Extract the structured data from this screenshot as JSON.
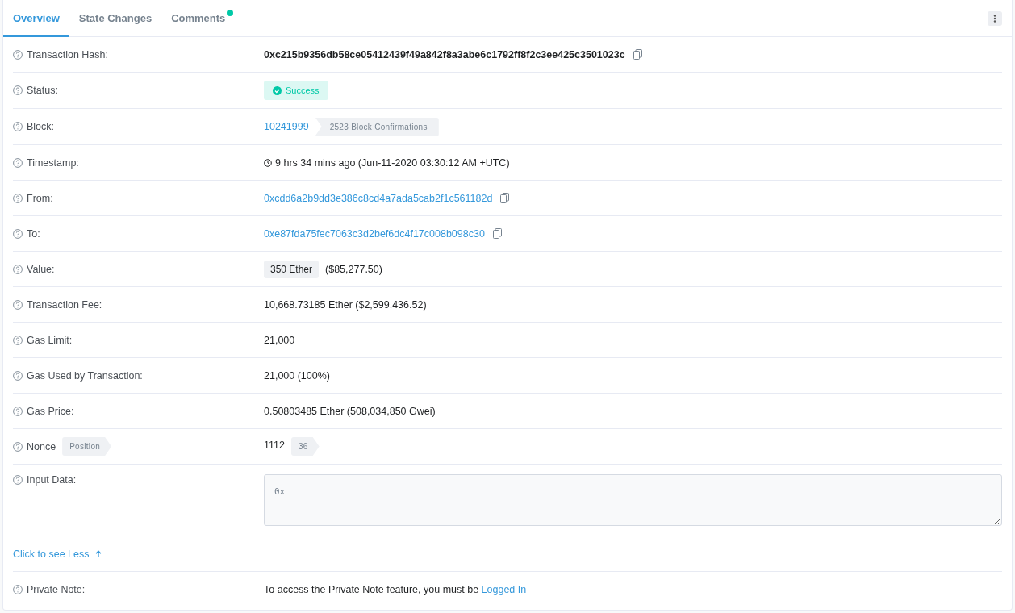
{
  "tabs": [
    {
      "label": "Overview",
      "selected": true,
      "dot": false
    },
    {
      "label": "State Changes",
      "selected": false,
      "dot": false
    },
    {
      "label": "Comments",
      "selected": false,
      "dot": true
    }
  ],
  "rows": [
    {
      "kind": "hash",
      "label": "Transaction Hash:",
      "value": "0xc215b9356db58ce05412439f49a842f8a3abe6c1792ff8f2c3ee425c3501023c"
    },
    {
      "kind": "status",
      "label": "Status:",
      "value": "Success"
    },
    {
      "kind": "block",
      "label": "Block:",
      "link": "10241999",
      "tag": "2523 Block Confirmations"
    },
    {
      "kind": "time",
      "label": "Timestamp:",
      "value": "9 hrs 34 mins ago (Jun-11-2020 03:30:12 AM +UTC)"
    },
    {
      "kind": "address",
      "label": "From:",
      "link": "0xcdd6a2b9dd3e386c8cd4a7ada5cab2f1c561182d"
    },
    {
      "kind": "address",
      "label": "To:",
      "link": "0xe87fda75fec7063c3d2bef6dc4f17c008b098c30"
    },
    {
      "kind": "amount",
      "label": "Value:",
      "tag": "350 Ether",
      "value": "($85,277.50)"
    },
    {
      "kind": "text",
      "label": "Transaction Fee:",
      "value": "10,668.73185 Ether ($2,599,436.52)"
    },
    {
      "kind": "text",
      "label": "Gas Limit:",
      "value": "21,000"
    },
    {
      "kind": "text",
      "label": "Gas Used by Transaction:",
      "value": "21,000 (100%)"
    },
    {
      "kind": "text",
      "label": "Gas Price:",
      "value": "0.50803485 Ether (508,034,850 Gwei)"
    },
    {
      "kind": "nonce",
      "label": "Nonce",
      "label_tag": "Position",
      "value": "1112",
      "tag": "36"
    },
    {
      "kind": "input",
      "label": "Input Data:",
      "value": "0x"
    }
  ],
  "toggle": {
    "label": "Click to see Less"
  },
  "private_note": {
    "label": "Private Note:",
    "text": "To access the Private Note feature, you must be",
    "link": "Logged In"
  }
}
